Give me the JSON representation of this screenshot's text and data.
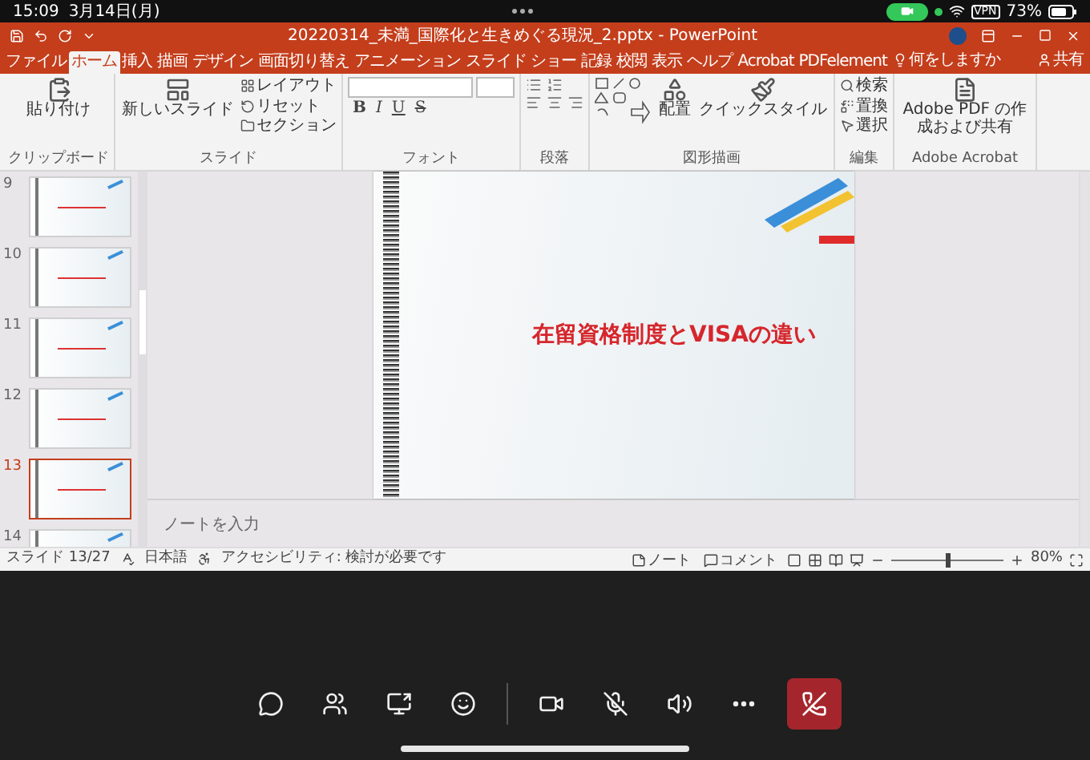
{
  "device_status": {
    "time": "15:09",
    "date": "3月14日(月)",
    "vpn": "VPN",
    "battery": "73%"
  },
  "window": {
    "title": "20220314_未満_国際化と生きめぐる現況_2.pptx - PowerPoint"
  },
  "ribbon_tabs": [
    {
      "label": "ファイル",
      "selected": false
    },
    {
      "label": "ホーム",
      "selected": true
    },
    {
      "label": "挿入",
      "selected": false
    },
    {
      "label": "描画",
      "selected": false
    },
    {
      "label": "デザイン",
      "selected": false
    },
    {
      "label": "画面切り替え",
      "selected": false
    },
    {
      "label": "アニメーション",
      "selected": false
    },
    {
      "label": "スライド ショー",
      "selected": false
    },
    {
      "label": "記録",
      "selected": false
    },
    {
      "label": "校閲",
      "selected": false
    },
    {
      "label": "表示",
      "selected": false
    },
    {
      "label": "ヘルプ",
      "selected": false
    },
    {
      "label": "Acrobat",
      "selected": false
    },
    {
      "label": "PDFelement",
      "selected": false
    }
  ],
  "tell_me": "何をしますか",
  "share": "共有",
  "ribbon_groups": [
    {
      "kind": "buttons",
      "label": "クリップボード",
      "large_buttons": [
        {
          "kind": "paste",
          "label": "貼り付け"
        }
      ]
    },
    {
      "kind": "buttons",
      "label": "スライド",
      "large_buttons": [
        {
          "kind": "new-slide",
          "label": "新しいスライド"
        }
      ],
      "small_buttons": [
        {
          "kind": "layout",
          "label": "レイアウト"
        },
        {
          "kind": "reset",
          "label": "リセット"
        },
        {
          "kind": "section",
          "label": "セクション"
        }
      ]
    },
    {
      "kind": "font",
      "label": "フォント",
      "format_buttons": [
        "B",
        "I",
        "U",
        "S"
      ]
    },
    {
      "kind": "paragraph",
      "label": "段落"
    },
    {
      "kind": "shapes",
      "label": "図形描画",
      "large_buttons": [
        {
          "kind": "arrange",
          "label": "配置"
        },
        {
          "kind": "quick-style",
          "label": "クイックスタイル"
        }
      ]
    },
    {
      "kind": "buttons",
      "label": "編集",
      "small_buttons": [
        {
          "kind": "find",
          "label": "検索"
        },
        {
          "kind": "replace",
          "label": "置換"
        },
        {
          "kind": "select",
          "label": "選択"
        }
      ]
    },
    {
      "kind": "buttons",
      "label": "Adobe Acrobat",
      "large_buttons": [
        {
          "kind": "pdf",
          "label": "Adobe PDF の作成および共有"
        }
      ]
    }
  ],
  "slides": [
    {
      "number": "9",
      "selected": false
    },
    {
      "number": "10",
      "selected": false
    },
    {
      "number": "11",
      "selected": false
    },
    {
      "number": "12",
      "selected": false
    },
    {
      "number": "13",
      "selected": true
    },
    {
      "number": "14",
      "selected": false
    }
  ],
  "current_slide": {
    "title": "在留資格制度とVISAの違い"
  },
  "notes": {
    "placeholder": "ノートを入力"
  },
  "status_bar": {
    "slide": "スライド 13/27",
    "language": "日本語",
    "accessibility": "アクセシビリティ: 検討が必要です",
    "notes": "ノート",
    "comments": "コメント",
    "zoom": "80%",
    "level": 0.5
  },
  "call_controls": [
    {
      "kind": "chat"
    },
    {
      "kind": "people"
    },
    {
      "kind": "share"
    },
    {
      "kind": "reactions"
    },
    {
      "kind": "divider"
    },
    {
      "kind": "camera"
    },
    {
      "kind": "mic",
      "muted": true
    },
    {
      "kind": "speaker"
    },
    {
      "kind": "more"
    },
    {
      "kind": "hangup"
    }
  ]
}
